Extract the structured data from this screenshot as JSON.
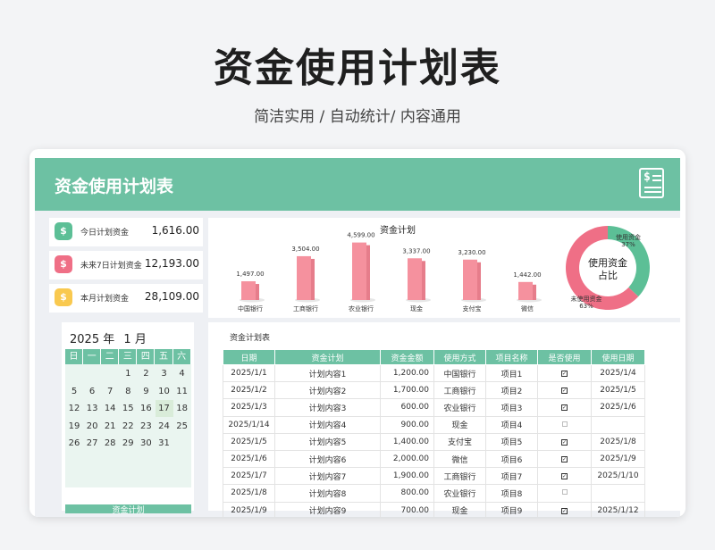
{
  "hero": {
    "title": "资金使用计划表",
    "subtitle": "简洁实用 / 自动统计/ 内容通用"
  },
  "banner": {
    "title": "资金使用计划表",
    "icon": "document-dollar-icon"
  },
  "stats": [
    {
      "label": "今日计划资金",
      "value": "1,616.00",
      "icon": "money-bag-icon",
      "color": "#5cbf96"
    },
    {
      "label": "未来7日计划资金",
      "value": "12,193.00",
      "icon": "money-bag-icon",
      "color": "#ef6f86"
    },
    {
      "label": "本月计划资金",
      "value": "28,109.00",
      "icon": "money-bag-icon",
      "color": "#f9c94f"
    }
  ],
  "chart_data": [
    {
      "type": "bar",
      "title": "资金计划",
      "categories": [
        "中国银行",
        "工商银行",
        "农业银行",
        "现金",
        "支付宝",
        "微信"
      ],
      "values": [
        1497,
        3504,
        4599,
        3337,
        3230,
        1442
      ],
      "value_labels": [
        "1,497.00",
        "3,504.00",
        "4,599.00",
        "3,337.00",
        "3,230.00",
        "1,442.00"
      ],
      "ylim": [
        0,
        5000
      ],
      "color": "#f5919e"
    },
    {
      "type": "pie",
      "title": "使用资金占比",
      "slices": [
        {
          "name": "使用资金",
          "value": 37,
          "label": "37%",
          "color": "#5cbf96"
        },
        {
          "name": "未使用资金",
          "value": 63,
          "label": "63%",
          "color": "#ef6f86"
        }
      ]
    }
  ],
  "calendar": {
    "year": "2025",
    "year_unit": "年",
    "month": "1",
    "month_unit": "月",
    "weekdays": [
      "日",
      "一",
      "二",
      "三",
      "四",
      "五",
      "六"
    ],
    "days": [
      [
        "",
        "",
        "",
        "1",
        "2",
        "3",
        "4"
      ],
      [
        "5",
        "6",
        "7",
        "8",
        "9",
        "10",
        "11"
      ],
      [
        "12",
        "13",
        "14",
        "15",
        "16",
        "17",
        "18"
      ],
      [
        "19",
        "20",
        "21",
        "22",
        "23",
        "24",
        "25"
      ],
      [
        "26",
        "27",
        "28",
        "29",
        "30",
        "31",
        ""
      ]
    ],
    "today": "17",
    "footer": "资金计划"
  },
  "table": {
    "title": "资金计划表",
    "columns": [
      "日期",
      "资金计划",
      "资金金额",
      "使用方式",
      "项目名称",
      "是否使用",
      "使用日期"
    ],
    "rows": [
      [
        "2025/1/1",
        "计划内容1",
        "1,200.00",
        "中国银行",
        "项目1",
        "checked",
        "2025/1/4"
      ],
      [
        "2025/1/2",
        "计划内容2",
        "1,700.00",
        "工商银行",
        "项目2",
        "checked",
        "2025/1/5"
      ],
      [
        "2025/1/3",
        "计划内容3",
        "600.00",
        "农业银行",
        "项目3",
        "checked",
        "2025/1/6"
      ],
      [
        "2025/1/14",
        "计划内容4",
        "900.00",
        "现金",
        "项目4",
        "unchecked",
        ""
      ],
      [
        "2025/1/5",
        "计划内容5",
        "1,400.00",
        "支付宝",
        "项目5",
        "checked",
        "2025/1/8"
      ],
      [
        "2025/1/6",
        "计划内容6",
        "2,000.00",
        "微信",
        "项目6",
        "checked",
        "2025/1/9"
      ],
      [
        "2025/1/7",
        "计划内容7",
        "1,900.00",
        "工商银行",
        "项目7",
        "checked",
        "2025/1/10"
      ],
      [
        "2025/1/8",
        "计划内容8",
        "800.00",
        "农业银行",
        "项目8",
        "unchecked",
        ""
      ],
      [
        "2025/1/9",
        "计划内容9",
        "700.00",
        "现金",
        "项目9",
        "checked",
        "2025/1/12"
      ]
    ]
  }
}
